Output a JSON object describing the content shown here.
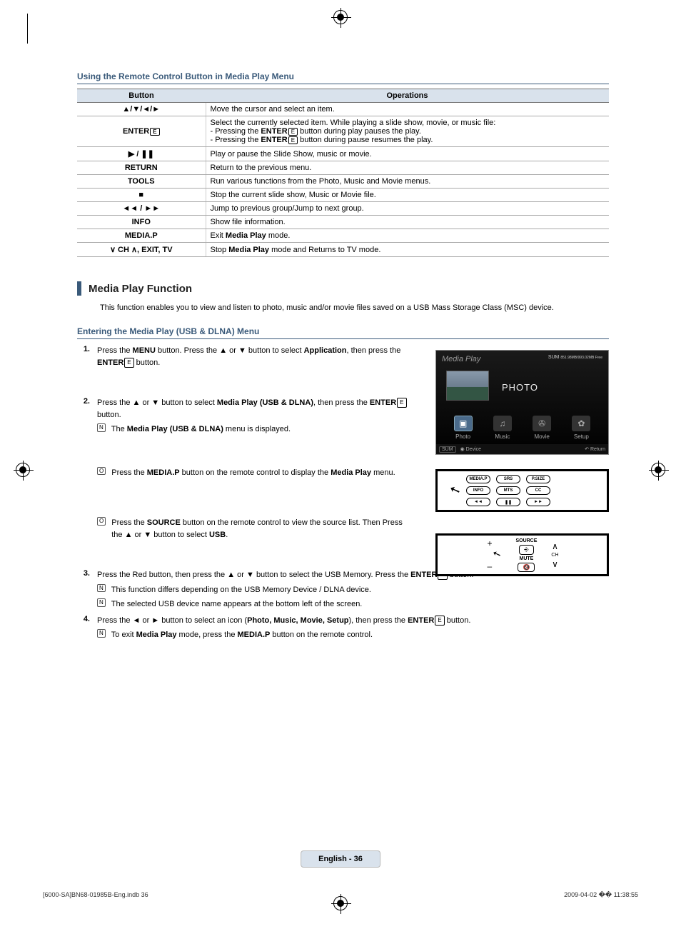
{
  "section1_title": "Using the Remote Control Button in Media Play Menu",
  "table": {
    "headers": {
      "button": "Button",
      "operations": "Operations"
    },
    "rows": [
      {
        "btn": "▲/▼/◄/►",
        "op": "Move the cursor and select an item."
      },
      {
        "btn": "ENTER",
        "op1": "Select the currently selected item. While playing a slide show, movie, or music file:",
        "op2a": "- Pressing the ",
        "op2b": "ENTER",
        "op2c": " button during play pauses the play.",
        "op3a": "- Pressing the ",
        "op3b": "ENTER",
        "op3c": " button during pause resumes the play."
      },
      {
        "btn": "▶ / ❚❚",
        "op": "Play or pause the Slide Show, music or movie."
      },
      {
        "btn": "RETURN",
        "op": "Return to the previous menu."
      },
      {
        "btn": "TOOLS",
        "op": "Run various functions from the Photo, Music and Movie menus."
      },
      {
        "btn": "■",
        "op": "Stop the current slide show, Music or Movie file."
      },
      {
        "btn": "◄◄ / ►►",
        "op": "Jump to previous group/Jump to next group."
      },
      {
        "btn": "INFO",
        "op": "Show file information."
      },
      {
        "btn": "MEDIA.P",
        "op1": "Exit ",
        "op2": "Media Play",
        "op3": " mode."
      },
      {
        "btn": "∨ CH ∧, EXIT, TV",
        "op1": "Stop ",
        "op2": "Media Play",
        "op3": " mode and Returns to TV mode."
      }
    ]
  },
  "heading2": "Media Play Function",
  "intro": "This function enables you to view and listen to photo, music and/or movie files saved on a USB Mass Storage Class (MSC) device.",
  "sub_heading": "Entering the Media Play (USB & DLNA) Menu",
  "step1": {
    "num": "1.",
    "t1": "Press the ",
    "t2": "MENU",
    "t3": " button. Press the ▲ or ▼ button to select ",
    "t4": "Application",
    "t5": ", then press the ",
    "t6": "ENTER",
    "t7": " button."
  },
  "step2": {
    "num": "2.",
    "t1": "Press the ▲ or ▼ button to select ",
    "t2": "Media Play (USB & DLNA)",
    "t3": ", then press the ",
    "t4": "ENTER",
    "t5": " button.",
    "note1a": "The ",
    "note1b": "Media Play (USB & DLNA)",
    "note1c": " menu is displayed.",
    "note2a": "Press the ",
    "note2b": "MEDIA.P",
    "note2c": " button on the remote control to display the ",
    "note2d": "Media Play",
    "note2e": " menu.",
    "note3a": "Press the ",
    "note3b": "SOURCE",
    "note3c": " button on the remote control to view the source list. Then Press the ▲ or ▼ button to select ",
    "note3d": "USB",
    "note3e": "."
  },
  "step3": {
    "num": "3.",
    "t1": "Press the Red button, then press the ▲ or ▼ button to select the USB Memory. Press the ",
    "t2": "ENTER",
    "t3": " button.",
    "note1": "This function differs depending on the USB Memory Device / DLNA device.",
    "note2": "The selected USB device name appears at the bottom left of the screen."
  },
  "step4": {
    "num": "4.",
    "t1": "Press the ◄ or ► button to select an icon (",
    "t2": "Photo, Music, Movie, Setup",
    "t3": "), then press the ",
    "t4": "ENTER",
    "t5": " button.",
    "note1a": "To exit ",
    "note1b": "Media Play",
    "note1c": " mode, press the ",
    "note1d": "MEDIA.P",
    "note1e": " button on the remote control."
  },
  "osd": {
    "title": "Media Play",
    "sum": "SUM",
    "sum_detail": "851.98MB/993.02MB Free",
    "photo": "PHOTO",
    "items": {
      "photo": "Photo",
      "music": "Music",
      "movie": "Movie",
      "setup": "Setup"
    },
    "bottom": {
      "sum": "SUM",
      "device": "Device",
      "ret": "Return"
    }
  },
  "remote1": {
    "b1": "MEDIA.P",
    "b2": "SRS",
    "b3": "P.SIZE",
    "b4": "INFO",
    "b5": "MTS",
    "b6": "CC",
    "b7": "◄◄",
    "b8": "❚❚",
    "b9": "►►"
  },
  "remote2": {
    "source": "SOURCE",
    "mute": "MUTE",
    "ch": "CH",
    "plus": "+",
    "minus": "–",
    "up": "∧",
    "down": "∨"
  },
  "footer_page": "English - 36",
  "print_left": "[6000-SA]BN68-01985B-Eng.indb   36",
  "print_right": "2009-04-02   �� 11:38:55",
  "enter_glyph": "E",
  "note_glyph_n": "N",
  "note_glyph_o": "O"
}
